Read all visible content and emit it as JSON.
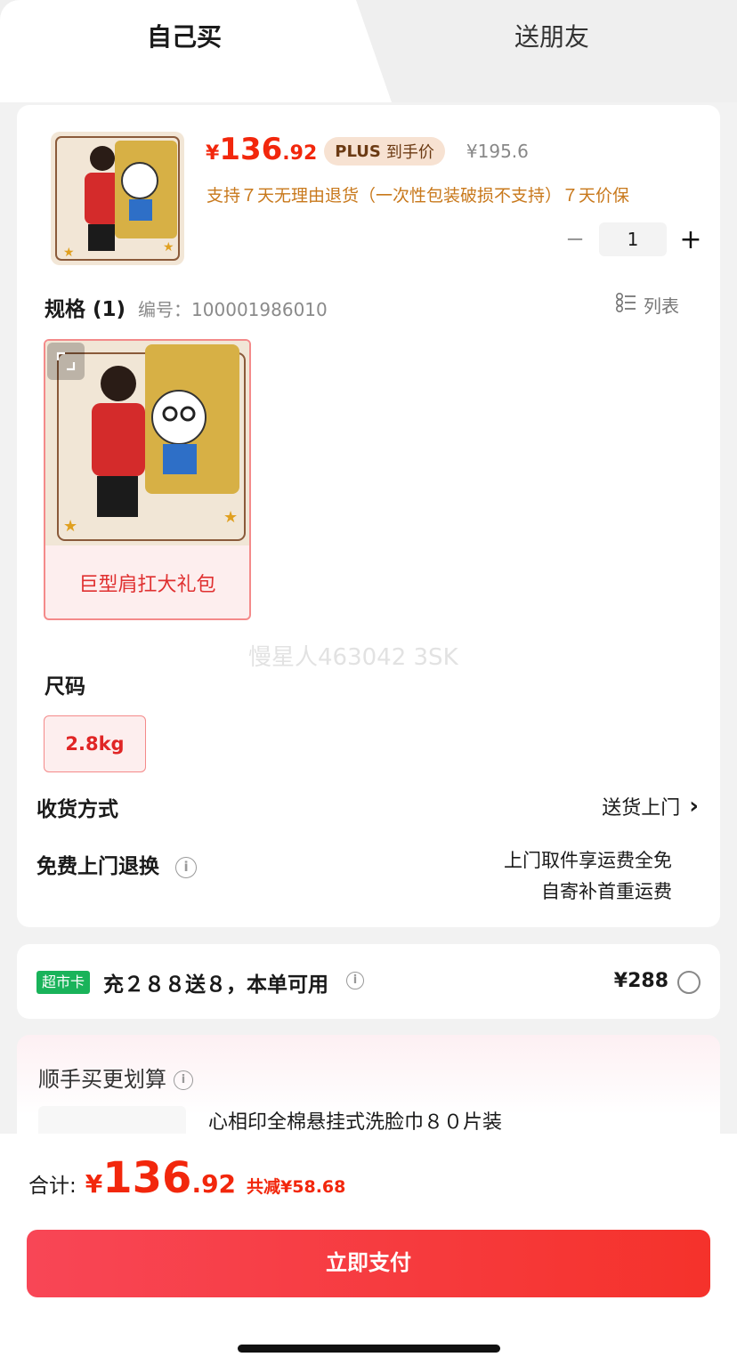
{
  "tabs": {
    "active": "自己买",
    "other": "送朋友"
  },
  "product": {
    "price_currency": "¥",
    "price_int": "136",
    "price_dec": ".92",
    "plus_bold": "PLUS",
    "plus_label": "到手价",
    "orig_price": "¥195.6",
    "return_policy": "支持７天无理由退货（一次性包装破损不支持）７天价保",
    "quantity": "1",
    "minus": "−",
    "plus": "+"
  },
  "spec": {
    "title": "规格 (1)",
    "code": "编号：100001986010",
    "list_label": "列表",
    "option_label": "巨型肩扛大礼包"
  },
  "watermark": "慢星人463042 3SK",
  "size": {
    "title": "尺码",
    "option": "2.8kg"
  },
  "delivery": {
    "label": "收货方式",
    "value": "送货上门",
    "chevron": "›"
  },
  "free_return": {
    "label": "免费上门退换",
    "line1": "上门取件享运费全免",
    "line2": "自寄补首重运费"
  },
  "market_card": {
    "badge": "超市卡",
    "text": "充２８８送８，本单可用",
    "price": "¥288"
  },
  "combo": {
    "title": "顺手买更划算",
    "item_title": "心相印全棉悬挂式洗脸巾８０片装"
  },
  "footer": {
    "total_label": "合计:",
    "total_currency": "¥",
    "total_int": "136",
    "total_dec": ".92",
    "total_save": "共减¥58.68",
    "pay_label": "立即支付"
  },
  "colors": {
    "accent": "#f2270c",
    "plus_badge_bg": "#f7e2d2",
    "policy": "#c8781b",
    "market_badge": "#19b35a"
  }
}
